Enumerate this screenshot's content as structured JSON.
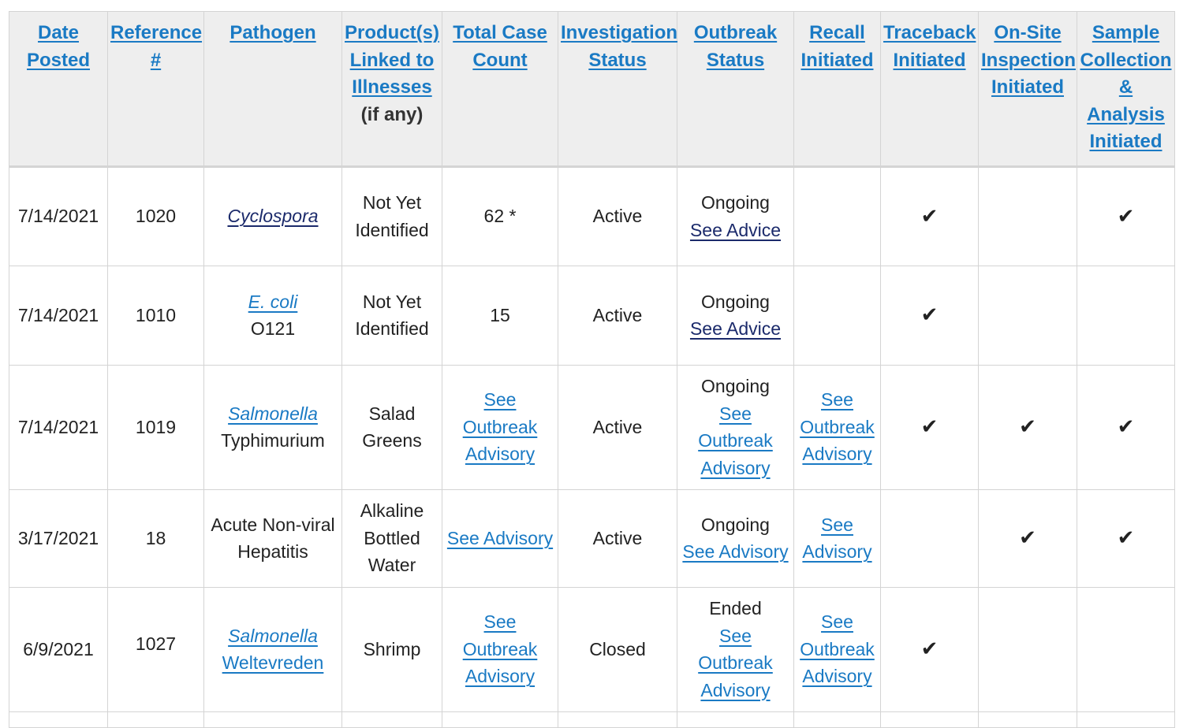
{
  "headers": [
    {
      "link": "Date Posted"
    },
    {
      "link": "Reference #"
    },
    {
      "link": "Pathogen"
    },
    {
      "link": "Product(s) Linked to Illnesses",
      "sub": "(if any)"
    },
    {
      "link": "Total Case Count"
    },
    {
      "link": "Investigation Status"
    },
    {
      "link": "Outbreak Status"
    },
    {
      "link": "Recall Initiated"
    },
    {
      "link": "Traceback Initiated"
    },
    {
      "link": "On-Site Inspection Initiated"
    },
    {
      "link": "Sample Collection & Analysis Initiated"
    }
  ],
  "check_mark": "✔",
  "rows": [
    {
      "date": "7/14/2021",
      "ref": "1020",
      "pathogen_link": "Cyclospora",
      "pathogen_rest": "",
      "product": "Not Yet Identified",
      "case_count": "62 *",
      "investigation": "Active",
      "outbreak_status": "Ongoing",
      "outbreak_link": "See Advice",
      "recall_link": "",
      "traceback": true,
      "onsite": false,
      "sample": true
    },
    {
      "date": "7/14/2021",
      "ref": "1010",
      "pathogen_link": "E. coli",
      "pathogen_rest": "O121",
      "product": "Not Yet Identified",
      "case_count": "15",
      "investigation": "Active",
      "outbreak_status": "Ongoing",
      "outbreak_link": "See Advice",
      "recall_link": "",
      "traceback": true,
      "onsite": false,
      "sample": false
    },
    {
      "date": "7/14/2021",
      "ref": "1019",
      "pathogen_link": "Salmonella",
      "pathogen_rest": "Typhimurium",
      "product": "Salad Greens",
      "case_count_link": "See Outbreak Advisory",
      "investigation": "Active",
      "outbreak_status": "Ongoing",
      "outbreak_link": "See Outbreak Advisory",
      "recall_link": "See Outbreak Advisory",
      "traceback": true,
      "onsite": true,
      "sample": true
    },
    {
      "date": "3/17/2021",
      "ref": "18",
      "pathogen_text": "Acute Non-viral Hepatitis",
      "product": "Alkaline Bottled Water",
      "case_count_link": "See Advisory",
      "investigation": "Active",
      "outbreak_status": "Ongoing",
      "outbreak_link": "See Advisory",
      "recall_link": "See Advisory",
      "traceback": false,
      "onsite": true,
      "sample": true
    },
    {
      "date": "6/9/2021",
      "ref": "1027",
      "pathogen_link": "Salmonella",
      "pathogen_link2": "Weltevreden",
      "product": "Shrimp",
      "case_count_link": "See Outbreak Advisory",
      "investigation": "Closed",
      "outbreak_status": "Ended",
      "outbreak_link": "See Outbreak Advisory",
      "recall_link": "See Outbreak Advisory",
      "traceback": true,
      "onsite": false,
      "sample": false
    }
  ]
}
